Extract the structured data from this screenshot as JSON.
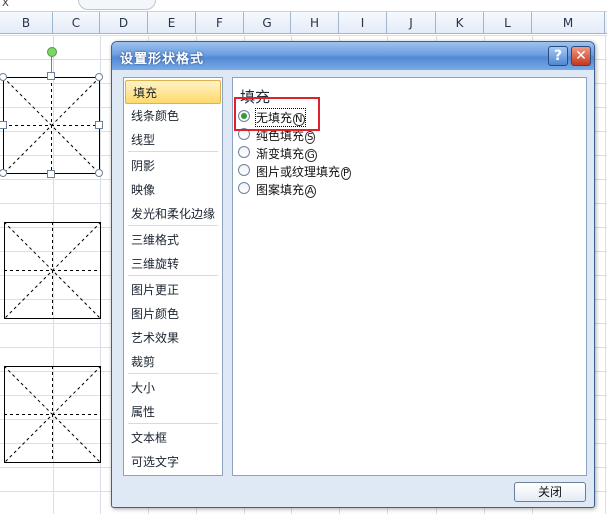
{
  "spreadsheet": {
    "namebox": "X",
    "columns": [
      "B",
      "C",
      "D",
      "E",
      "F",
      "G",
      "H",
      "I",
      "J",
      "K",
      "L",
      "M"
    ]
  },
  "dialog": {
    "title": "设置形状格式",
    "help_icon": "?",
    "close_icon": "✕",
    "nav_items": [
      "填充",
      "线条颜色",
      "线型",
      "阴影",
      "映像",
      "发光和柔化边缘",
      "三维格式",
      "三维旋转",
      "图片更正",
      "图片颜色",
      "艺术效果",
      "裁剪",
      "大小",
      "属性",
      "文本框",
      "可选文字"
    ],
    "selected_nav": "填充",
    "section_title": "填充",
    "fill_options": [
      {
        "label": "无填充",
        "key": "N",
        "checked": true
      },
      {
        "label": "纯色填充",
        "key": "S",
        "checked": false
      },
      {
        "label": "渐变填充",
        "key": "G",
        "checked": false
      },
      {
        "label": "图片或纹理填充",
        "key": "P",
        "checked": false
      },
      {
        "label": "图案填充",
        "key": "A",
        "checked": false
      }
    ],
    "close_button": "关闭"
  },
  "colors": {
    "titlebar": "#5289d4",
    "nav_selected": "#ffd96c",
    "highlight": "#e0212b",
    "radio_checked": "#2f9b35"
  }
}
